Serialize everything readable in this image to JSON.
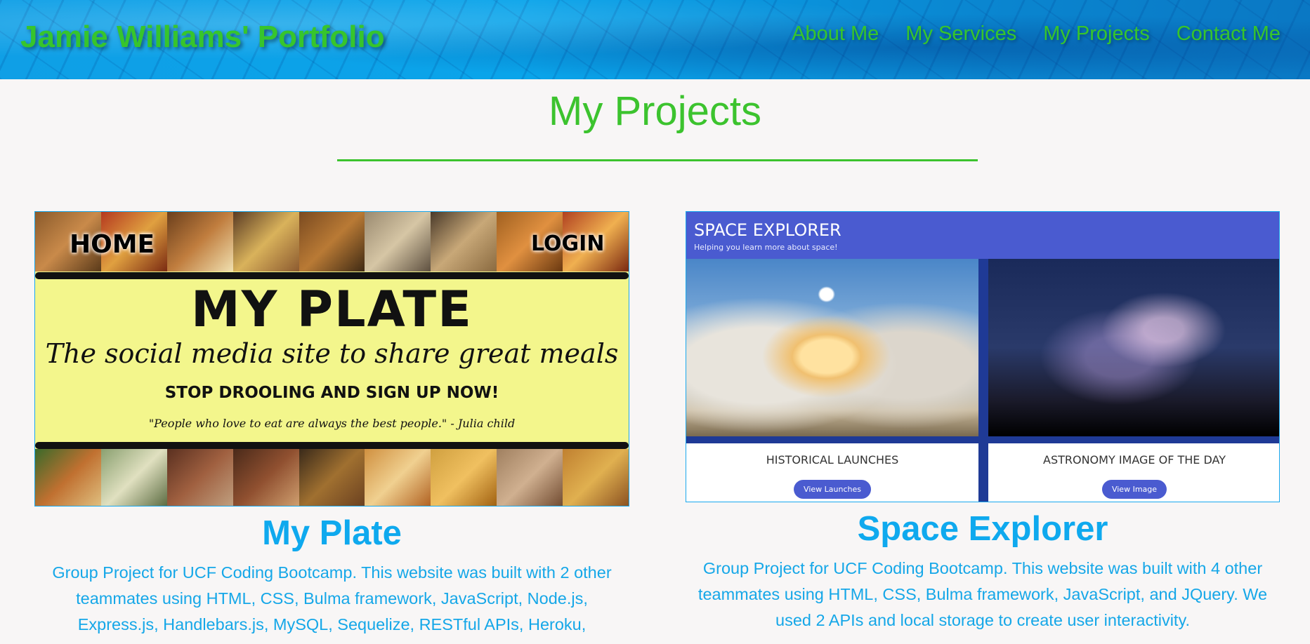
{
  "header": {
    "brand": "Jamie Williams' Portfolio",
    "nav": [
      "About Me",
      "My Services",
      "My Projects",
      "Contact Me"
    ]
  },
  "section": {
    "title": "My Projects"
  },
  "projects": [
    {
      "title": "My Plate",
      "description": "Group Project for UCF Coding Bootcamp. This website was built with 2 other teammates using HTML, CSS, Bulma framework, JavaScript, Node.js, Express.js, Handlebars.js, MySQL, Sequelize, RESTful APIs, Heroku,",
      "thumbnail": {
        "nav_home": "HOME",
        "nav_login": "LOGIN",
        "heading": "MY PLATE",
        "tagline": "The social media site to share great meals",
        "cta": "STOP DROOLING AND SIGN UP NOW!",
        "quote": "\"People who love to eat are always the best people.\" - Julia child"
      }
    },
    {
      "title": "Space Explorer",
      "description": "Group Project for UCF Coding Bootcamp. This website was built with 4 other teammates using HTML, CSS, Bulma framework, JavaScript, and JQuery. We used 2 APIs and local storage to create user interactivity.",
      "thumbnail": {
        "site_name": "SPACE EXPLORER",
        "site_tagline": "Helping you learn more about space!",
        "box1_label": "HISTORICAL LAUNCHES",
        "box1_button": "View Launches",
        "box2_label": "ASTRONOMY IMAGE OF THE DAY",
        "box2_button": "View Image"
      }
    }
  ]
}
